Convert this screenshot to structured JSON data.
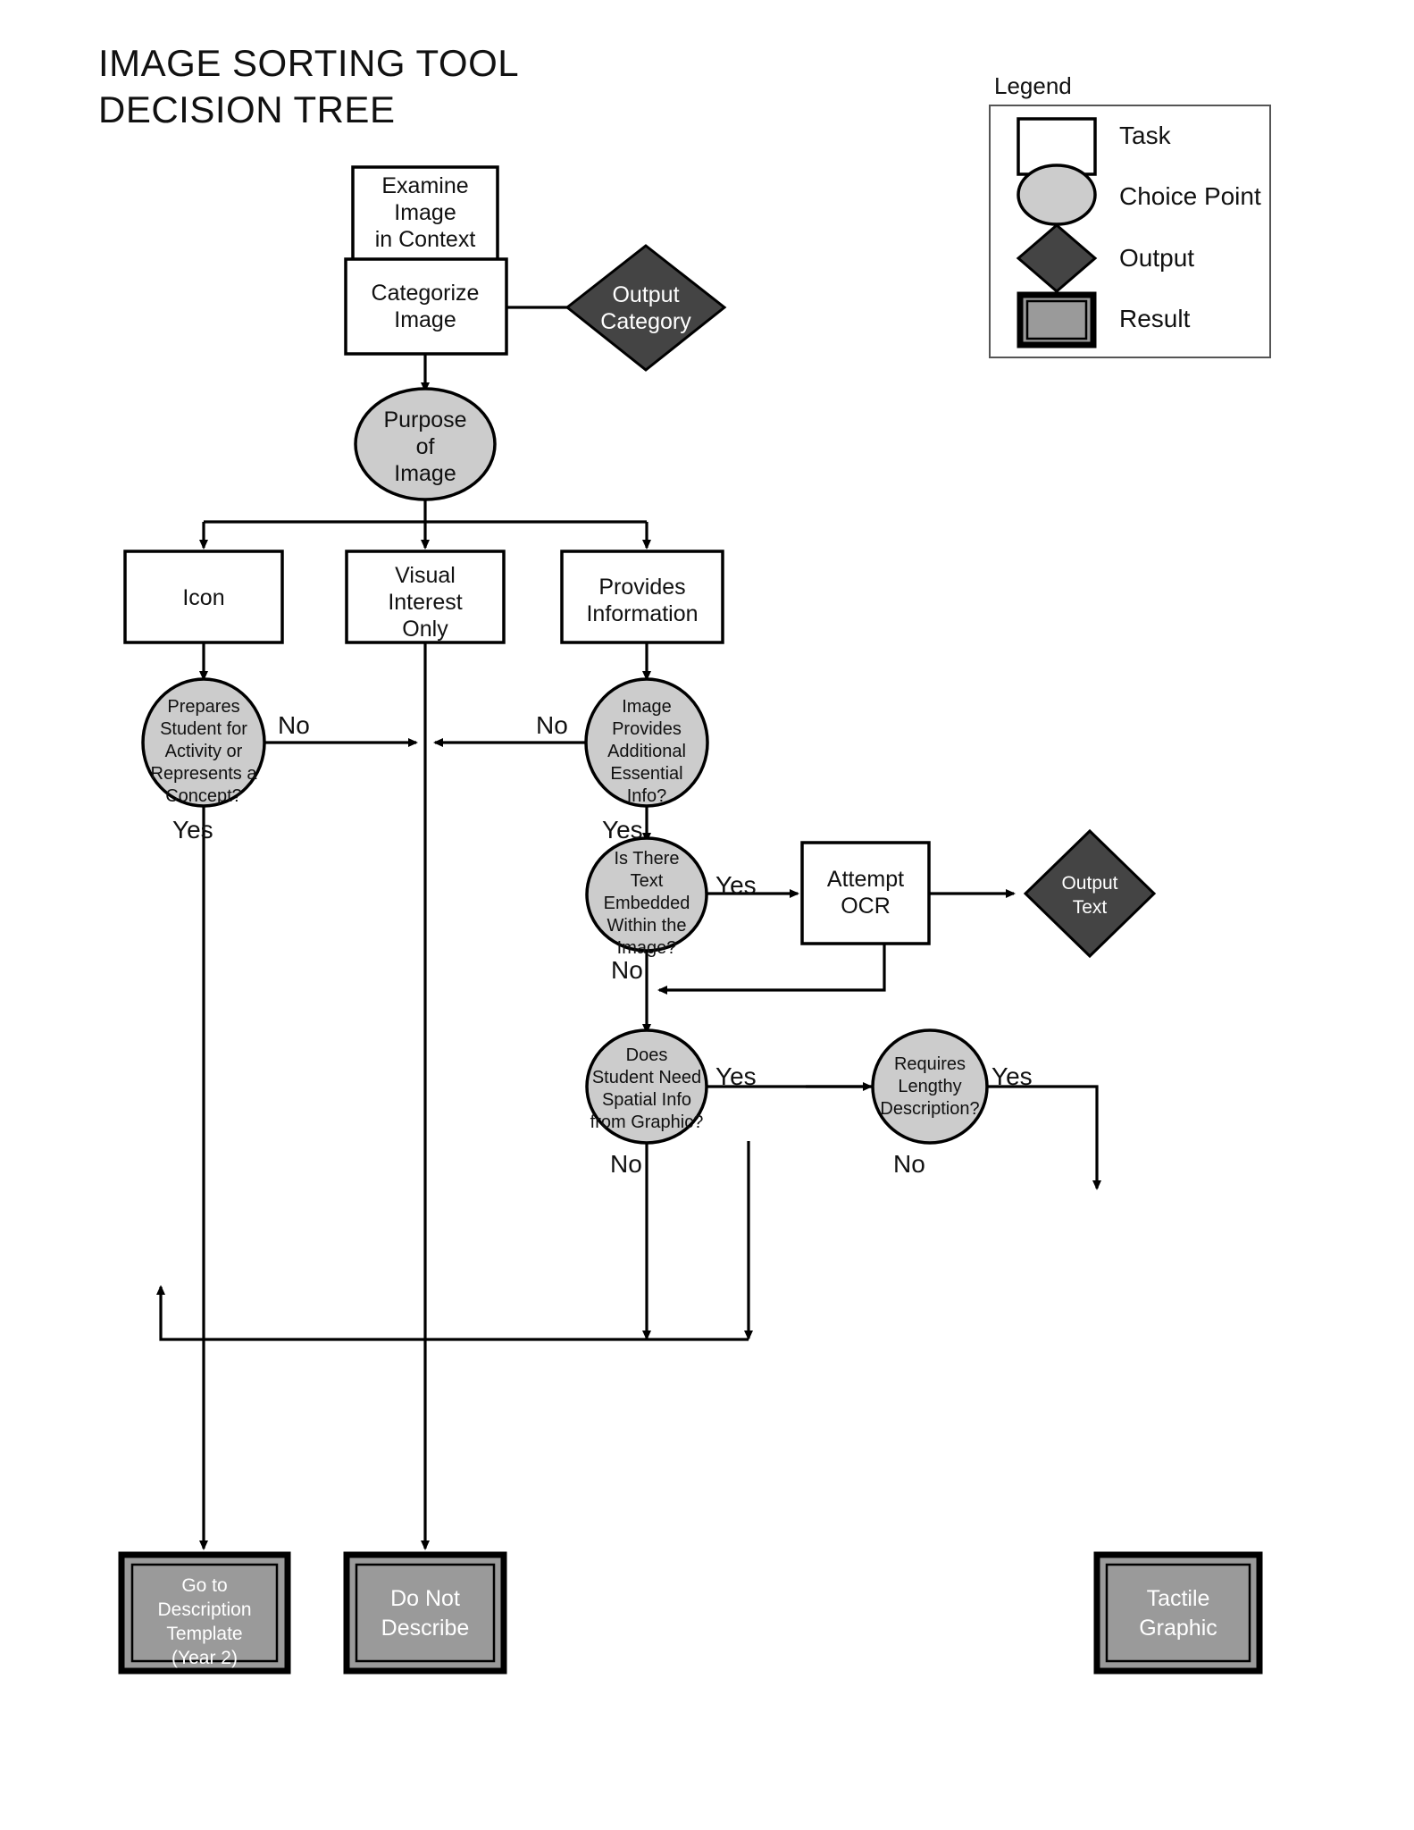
{
  "title": {
    "line1": "IMAGE SORTING TOOL",
    "line2": "DECISION TREE"
  },
  "legend": {
    "heading": "Legend",
    "items": [
      {
        "shape": "rectangle",
        "label": "Task",
        "fill": "#ffffff"
      },
      {
        "shape": "circle",
        "label": "Choice Point",
        "fill": "#cccccc"
      },
      {
        "shape": "diamond",
        "label": "Output",
        "fill": "#444444"
      },
      {
        "shape": "double-rectangle",
        "label": "Result",
        "fill": "#9a9a9a"
      }
    ]
  },
  "nodes": {
    "examine_image": {
      "type": "task",
      "lines": [
        "Examine",
        "Image",
        "in Context"
      ]
    },
    "categorize_image": {
      "type": "task",
      "lines": [
        "Categorize",
        "Image"
      ]
    },
    "output_category": {
      "type": "output",
      "lines": [
        "Output",
        "Category"
      ]
    },
    "purpose_of_image": {
      "type": "choice",
      "lines": [
        "Purpose",
        "of",
        "Image"
      ]
    },
    "icon": {
      "type": "task",
      "lines": [
        "Icon"
      ]
    },
    "visual_interest_only": {
      "type": "task",
      "lines": [
        "Visual",
        "Interest",
        "Only"
      ]
    },
    "provides_information": {
      "type": "task",
      "lines": [
        "Provides",
        "Information"
      ]
    },
    "prepares_student": {
      "type": "choice",
      "lines": [
        "Prepares",
        "Student for",
        "Activity or",
        "Represents a",
        "Concept?"
      ]
    },
    "image_provides_info": {
      "type": "choice",
      "lines": [
        "Image",
        "Provides",
        "Additional",
        "Essential",
        "Info?"
      ]
    },
    "text_embedded": {
      "type": "choice",
      "lines": [
        "Is There",
        "Text",
        "Embedded",
        "Within the",
        "Image?"
      ]
    },
    "attempt_ocr": {
      "type": "task",
      "lines": [
        "Attempt",
        "OCR"
      ]
    },
    "output_text": {
      "type": "output",
      "lines": [
        "Output",
        "Text"
      ]
    },
    "spatial_info": {
      "type": "choice",
      "lines": [
        "Does",
        "Student Need",
        "Spatial Info",
        "from Graphic?"
      ]
    },
    "lengthy_description": {
      "type": "choice",
      "lines": [
        "Requires",
        "Lengthy",
        "Description?"
      ]
    },
    "description_template": {
      "type": "result",
      "lines": [
        "Go to",
        "Description",
        "Template",
        "(Year 2)"
      ]
    },
    "do_not_describe": {
      "type": "result",
      "lines": [
        "Do Not",
        "Describe"
      ]
    },
    "tactile_graphic": {
      "type": "result",
      "lines": [
        "Tactile",
        "Graphic"
      ]
    }
  },
  "edge_labels": {
    "prepares_no": "No",
    "prepares_yes": "Yes",
    "provides_info_no": "No",
    "provides_info_yes": "Yes",
    "text_embedded_yes": "Yes",
    "text_embedded_no": "No",
    "spatial_yes": "Yes",
    "spatial_no": "No",
    "lengthy_yes": "Yes",
    "lengthy_no": "No"
  },
  "colors": {
    "task_fill": "#ffffff",
    "choice_fill": "#cccccc",
    "output_fill": "#444444",
    "result_fill": "#9a9a9a",
    "stroke": "#000000"
  }
}
